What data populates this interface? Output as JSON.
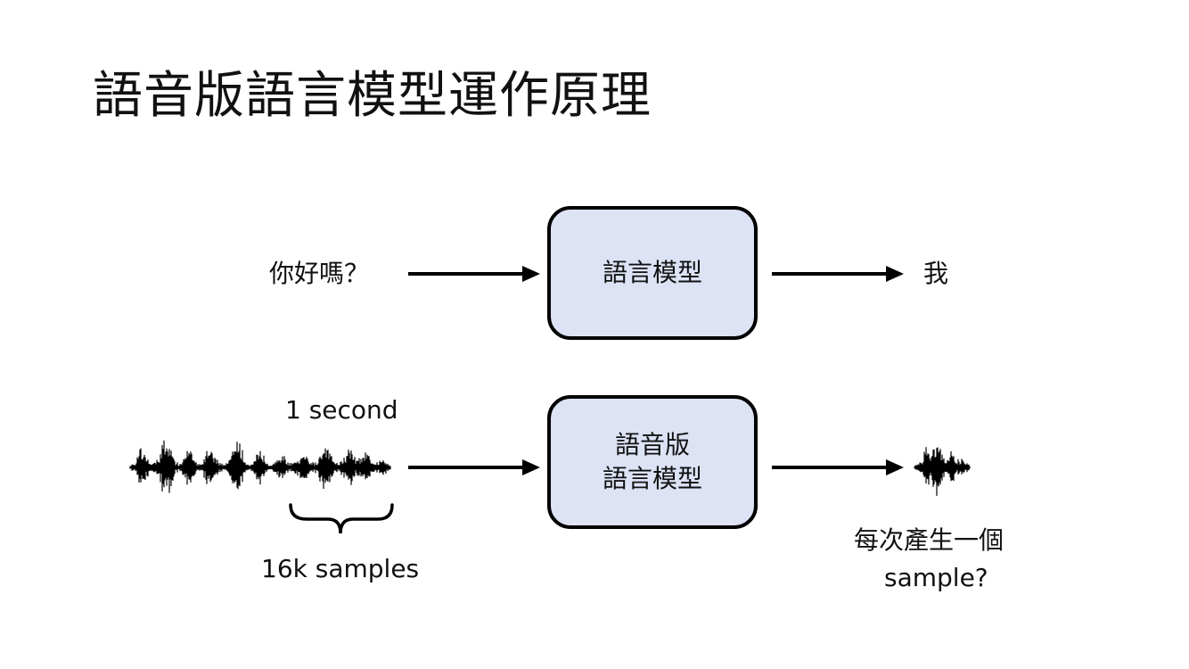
{
  "slide": {
    "title": "語音版語言模型運作原理"
  },
  "text_row": {
    "input_label": "你好嗎？",
    "model_label": "語言模型",
    "output_label": "我"
  },
  "speech_row": {
    "duration_label": "1 second",
    "samples_label": "16k samples",
    "model_line1": "語音版",
    "model_line2": "語言模型",
    "output_line1": "每次產生一個",
    "output_line2": "sample?"
  },
  "colors": {
    "box_fill": "#dde3f5",
    "stroke": "#000000"
  }
}
